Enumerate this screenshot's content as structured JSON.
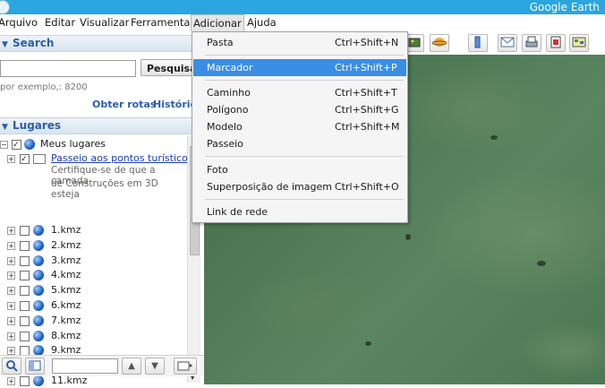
{
  "window": {
    "title": "Google Earth"
  },
  "menubar": {
    "items": [
      {
        "label": "Arquivo"
      },
      {
        "label": "Editar"
      },
      {
        "label": "Visualizar"
      },
      {
        "label": "Ferramentas"
      },
      {
        "label": "Adicionar"
      },
      {
        "label": "Ajuda"
      }
    ]
  },
  "search": {
    "header": "Search",
    "button": "Pesquisa",
    "hint": "por exemplo,: 8200",
    "link_routes": "Obter rotas",
    "link_history": "Históric"
  },
  "places": {
    "header": "Lugares",
    "root": "Meus lugares",
    "tour": "Passeio aos pontos turísticos",
    "tour_desc_1": "Certifique-se de que a camada",
    "tour_desc_2": "de Construções em 3D esteja",
    "files": [
      "1.kmz",
      "2.kmz",
      "3.kmz",
      "4.kmz",
      "5.kmz",
      "6.kmz",
      "7.kmz",
      "8.kmz",
      "9.kmz",
      "10.kmz",
      "11.kmz"
    ]
  },
  "add_menu": {
    "items": [
      {
        "label": "Pasta",
        "shortcut": "Ctrl+Shift+N"
      },
      {
        "label": "Marcador",
        "shortcut": "Ctrl+Shift+P"
      },
      {
        "label": "Caminho",
        "shortcut": "Ctrl+Shift+T"
      },
      {
        "label": "Polígono",
        "shortcut": "Ctrl+Shift+G"
      },
      {
        "label": "Modelo",
        "shortcut": "Ctrl+Shift+M"
      },
      {
        "label": "Passeio",
        "shortcut": ""
      },
      {
        "label": "Foto",
        "shortcut": ""
      },
      {
        "label": "Superposição de imagem",
        "shortcut": "Ctrl+Shift+O"
      },
      {
        "label": "Link de rede",
        "shortcut": ""
      }
    ],
    "highlighted": "Marcador"
  },
  "colors": {
    "titlebar": "#2aa6e0",
    "menu_highlight": "#3a8ee6",
    "panel_header_text": "#2b5ea8",
    "link": "#1a3fb7"
  }
}
